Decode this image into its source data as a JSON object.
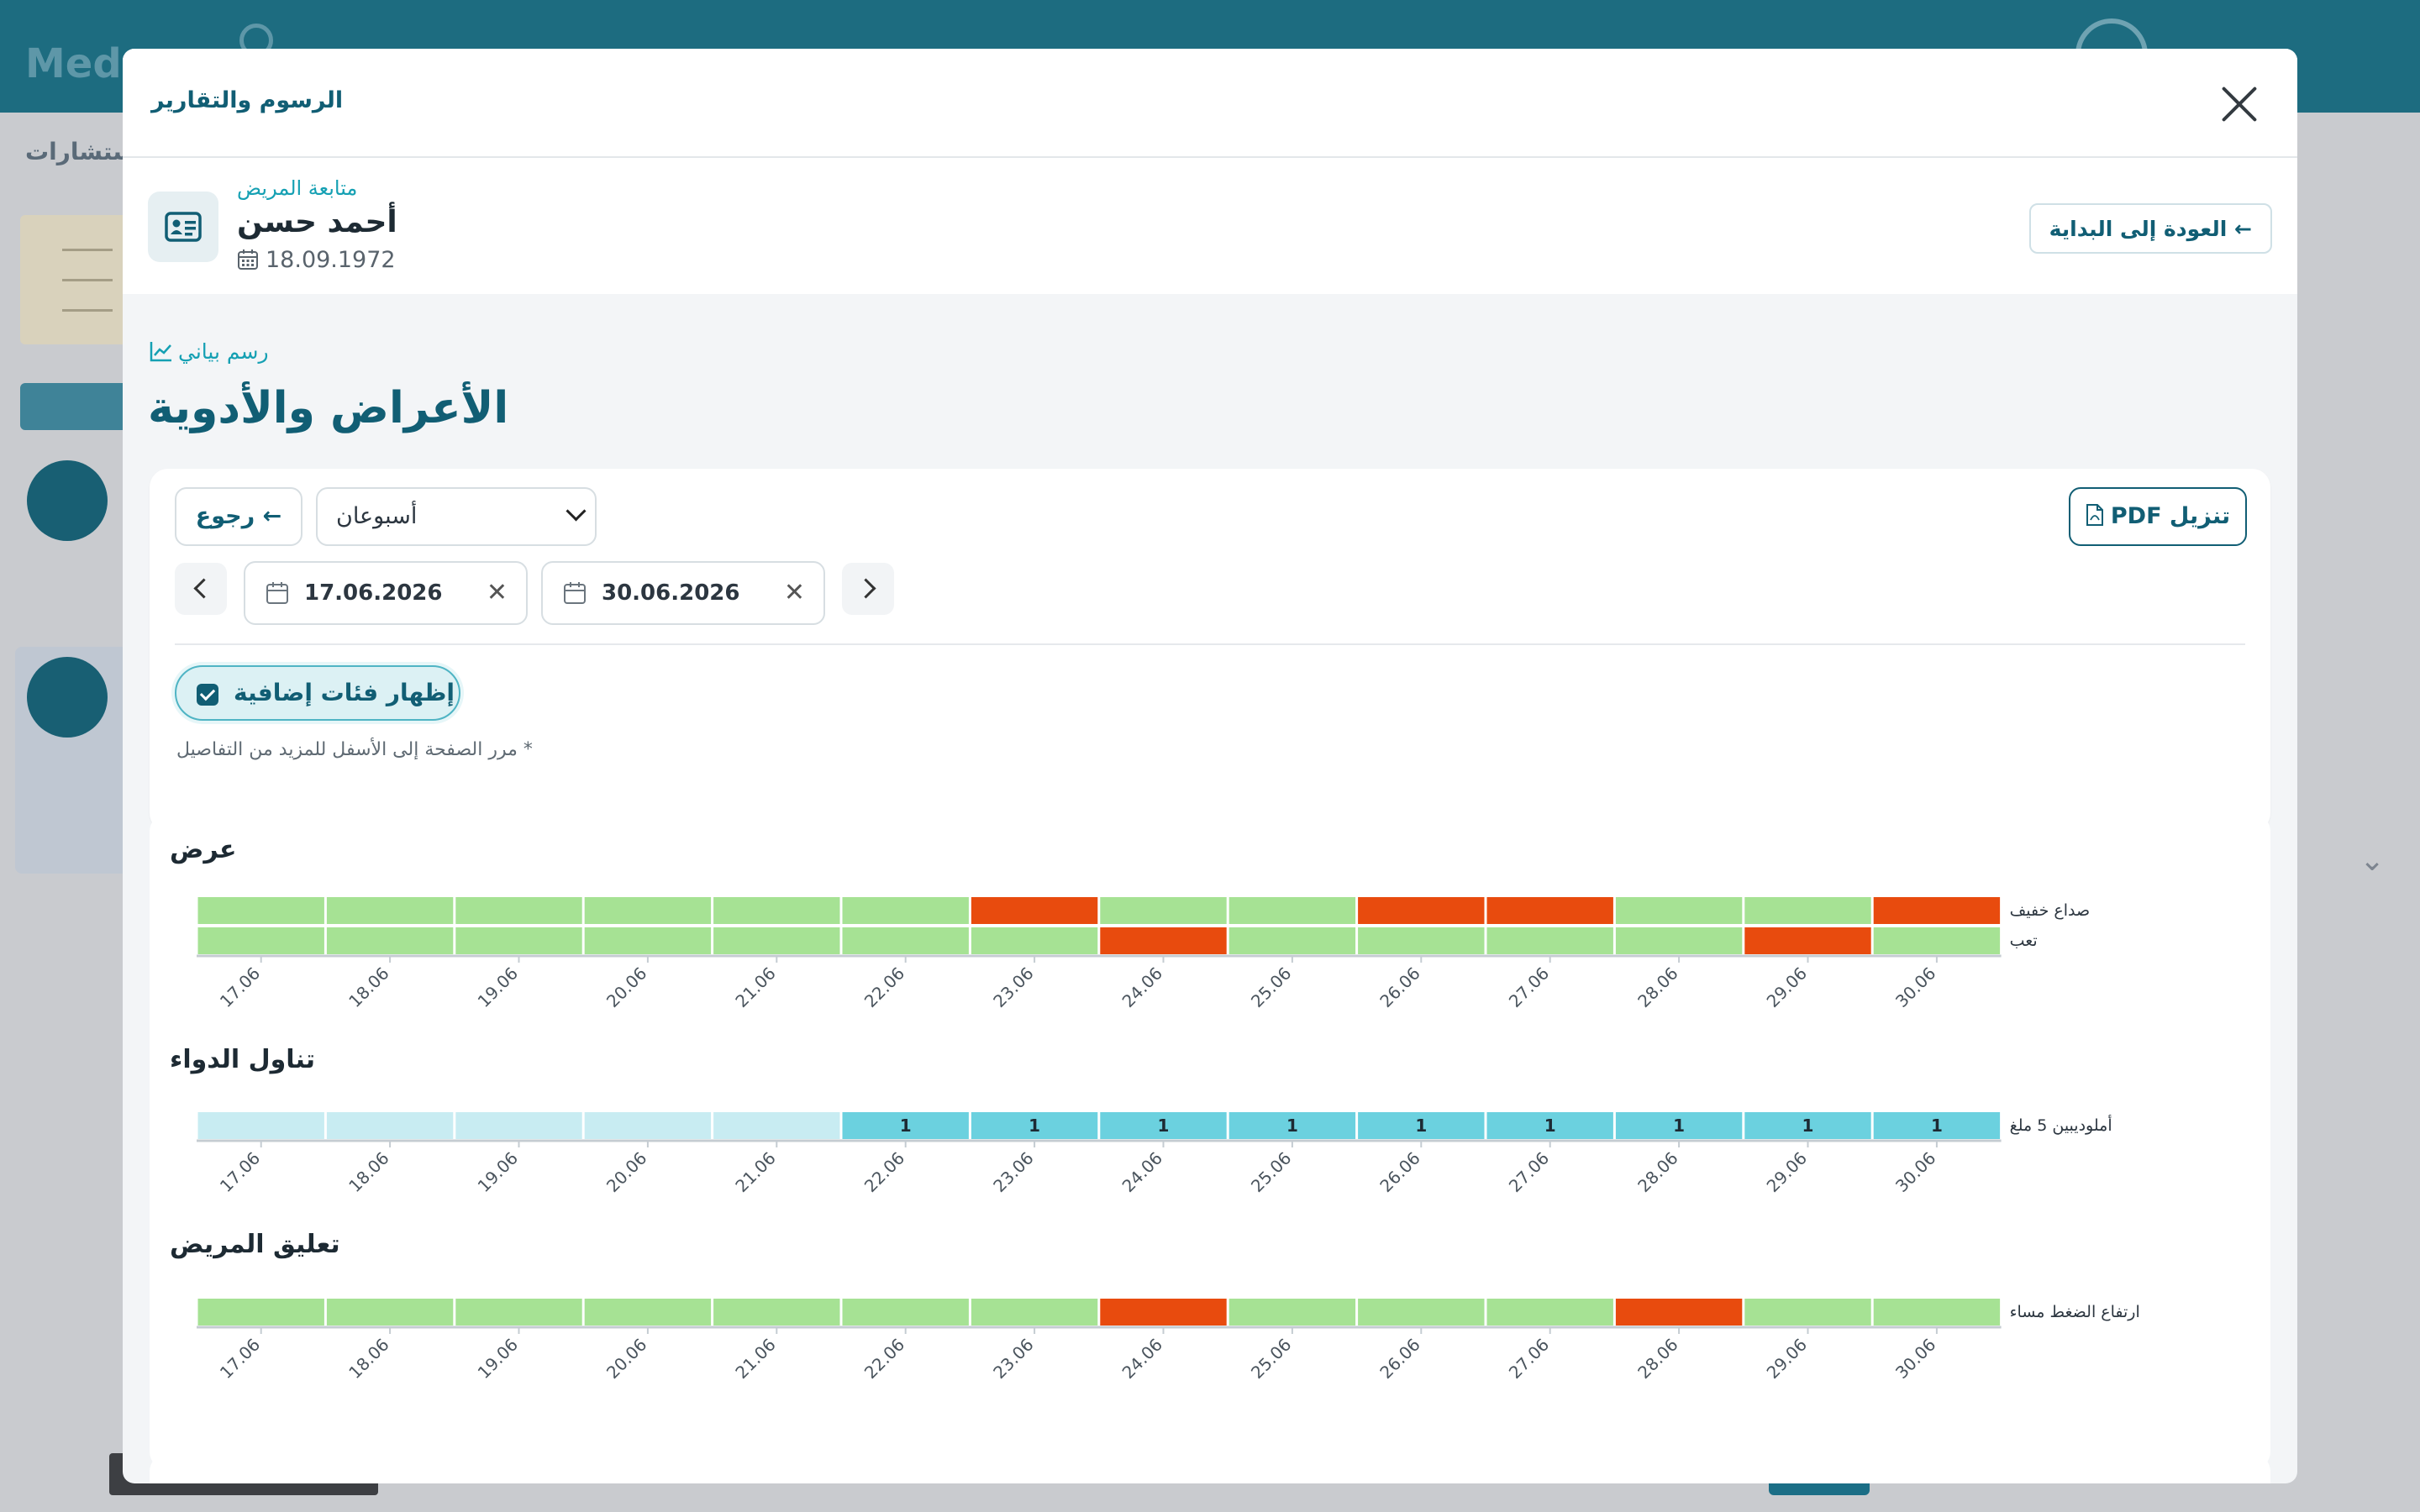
{
  "background": {
    "logo": "Meds",
    "tab": "ستشارات"
  },
  "modal": {
    "title": "الرسوم والتقارير"
  },
  "patient": {
    "section": "متابعة المريض",
    "name": "أحمد حسن",
    "dob": "18.09.1972",
    "back_home": "العودة إلى البداية ←"
  },
  "page": {
    "link": "رسم بياني",
    "title": "الأعراض والأدوية"
  },
  "filters": {
    "back_label": "رجوع ←",
    "range": "أسبوعان",
    "date_from": "17.06.2026",
    "date_to": "30.06.2026",
    "pdf_label": "PDF تنزيل",
    "toggle_label": "إظهار فئات إضافية",
    "hint": "مرر الصفحة إلى الأسفل للمزيد من التفاصيل *"
  },
  "colors": {
    "good": "#a6e294",
    "bad": "#e84b0e",
    "med_empty": "#c8ecf2",
    "med_taken": "#6bd1df"
  },
  "chart_data": [
    {
      "type": "heatmap",
      "title": "عرض",
      "x": [
        "17.06",
        "18.06",
        "19.06",
        "20.06",
        "21.06",
        "22.06",
        "23.06",
        "24.06",
        "25.06",
        "26.06",
        "27.06",
        "28.06",
        "29.06",
        "30.06"
      ],
      "series": [
        {
          "name": "صداع خفيف",
          "values": [
            0,
            0,
            0,
            0,
            0,
            0,
            1,
            0,
            0,
            1,
            1,
            0,
            0,
            1
          ]
        },
        {
          "name": "تعب",
          "values": [
            0,
            0,
            0,
            0,
            0,
            0,
            0,
            1,
            0,
            0,
            0,
            0,
            1,
            0
          ]
        }
      ]
    },
    {
      "type": "heatmap",
      "title": "تناول الدواء",
      "x": [
        "17.06",
        "18.06",
        "19.06",
        "20.06",
        "21.06",
        "22.06",
        "23.06",
        "24.06",
        "25.06",
        "26.06",
        "27.06",
        "28.06",
        "29.06",
        "30.06"
      ],
      "series": [
        {
          "name": "أملوديبين 5 ملغ",
          "values": [
            0,
            0,
            0,
            0,
            0,
            1,
            1,
            1,
            1,
            1,
            1,
            1,
            1,
            1
          ]
        }
      ]
    },
    {
      "type": "heatmap",
      "title": "تعليق المريض",
      "x": [
        "17.06",
        "18.06",
        "19.06",
        "20.06",
        "21.06",
        "22.06",
        "23.06",
        "24.06",
        "25.06",
        "26.06",
        "27.06",
        "28.06",
        "29.06",
        "30.06"
      ],
      "series": [
        {
          "name": "ارتفاع الضغط مساء",
          "values": [
            0,
            0,
            0,
            0,
            0,
            0,
            0,
            1,
            0,
            0,
            0,
            1,
            0,
            0
          ]
        }
      ]
    }
  ]
}
